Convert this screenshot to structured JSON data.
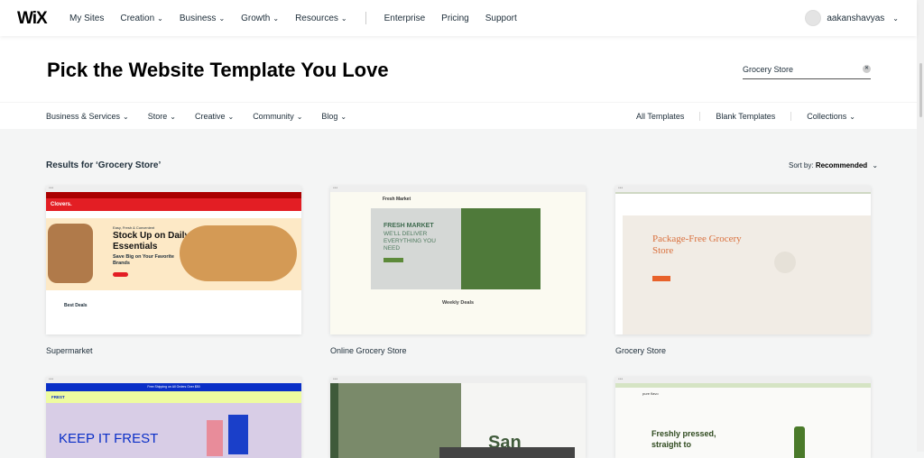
{
  "header": {
    "logo": "WiX",
    "nav": [
      {
        "label": "My Sites",
        "chevron": false
      },
      {
        "label": "Creation",
        "chevron": true
      },
      {
        "label": "Business",
        "chevron": true
      },
      {
        "label": "Growth",
        "chevron": true
      },
      {
        "label": "Resources",
        "chevron": true
      }
    ],
    "nav2": [
      "Enterprise",
      "Pricing",
      "Support"
    ],
    "username": "aakanshavyas"
  },
  "hero": {
    "title": "Pick the Website Template You Love",
    "search_value": "Grocery Store"
  },
  "categories": {
    "left": [
      "Business & Services",
      "Store",
      "Creative",
      "Community",
      "Blog"
    ],
    "right": [
      "All Templates",
      "Blank Templates",
      "Collections"
    ]
  },
  "results": {
    "heading": "Results for ‘Grocery Store’",
    "sort_label": "Sort by:",
    "sort_value": "Recommended"
  },
  "templates": [
    {
      "name": "Supermarket",
      "brand": "Clovers.",
      "tag": "Easy, Fresh & Convenient",
      "headline": "Stock Up on Daily Essentials",
      "sub": "Save Big on Your Favorite Brands",
      "section": "Best Deals",
      "accent": "#e31e24"
    },
    {
      "name": "Online Grocery Store",
      "brand": "Fresh Market",
      "headline": "FRESH MARKET",
      "sub": "WE'LL DELIVER EVERYTHING YOU NEED",
      "section": "Weekly Deals",
      "accent": "#3f6b4f"
    },
    {
      "name": "Grocery Store",
      "headline": "Package-Free Grocery Store",
      "accent": "#e8622b"
    },
    {
      "name": "",
      "banner": "Free Shipping on All Orders Over $50",
      "brand": "FREST",
      "headline": "KEEP IT FREST",
      "accent": "#0a2fc7"
    },
    {
      "name": "",
      "headline": "San",
      "accent": "#3f5a3a"
    },
    {
      "name": "",
      "brand": "pure flavo",
      "headline": "Freshly pressed, straight to",
      "accent": "#4a7a2a"
    }
  ]
}
